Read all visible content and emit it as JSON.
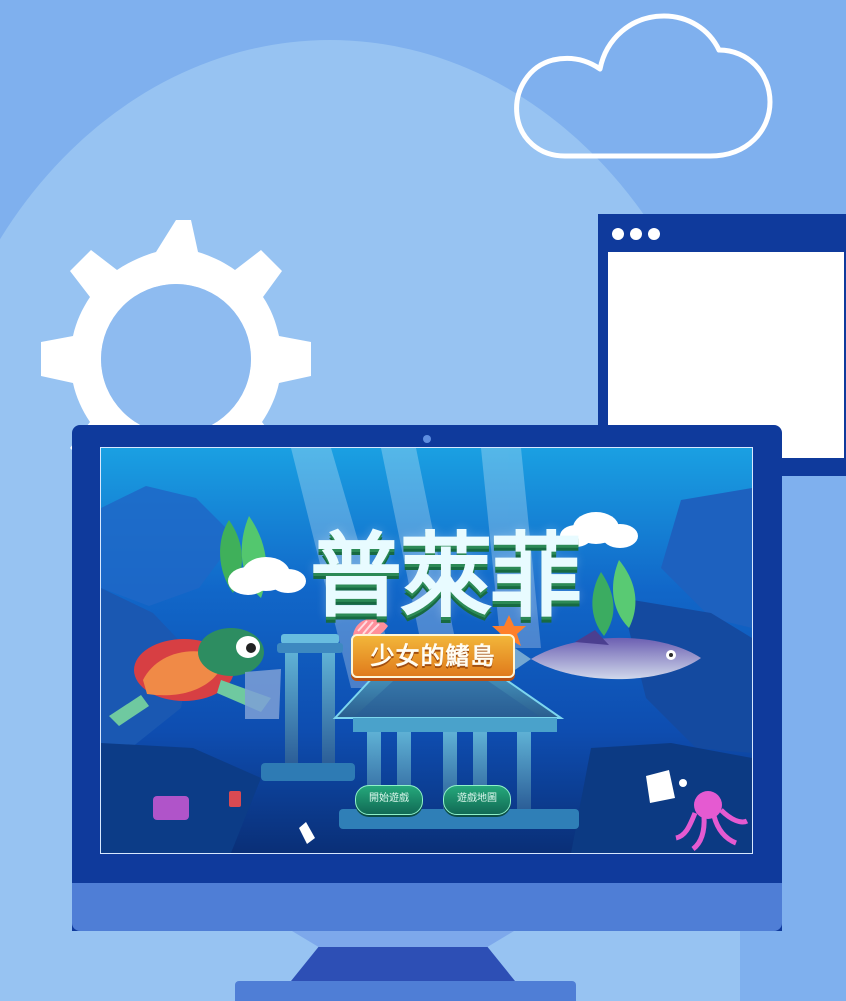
{
  "illustration": {
    "cloud_icon": "cloud-outline-icon",
    "gear_icon": "gear-icon"
  },
  "browser_window": {
    "dots_icon": "window-dots-icon"
  },
  "game_screen": {
    "title": "普萊菲",
    "subtitle": "少女的鰭島",
    "buttons": {
      "start": "開始遊戲",
      "map": "遊戲地圖"
    },
    "colors": {
      "accent_green": "#25a87b",
      "subtitle_orange": "#e07b1c",
      "screen_blue": "#0f5ab9"
    }
  }
}
